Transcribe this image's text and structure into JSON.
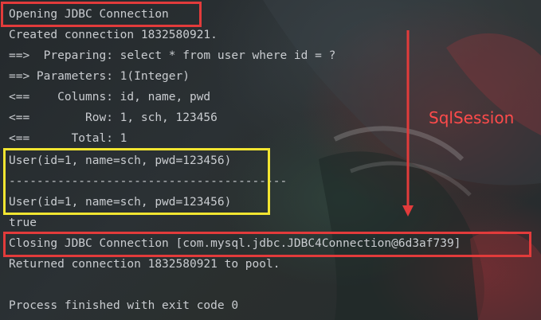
{
  "console": {
    "lines": [
      "Opening JDBC Connection",
      "Created connection 1832580921.",
      "==>  Preparing: select * from user where id = ?",
      "==> Parameters: 1(Integer)",
      "<==    Columns: id, name, pwd",
      "<==        Row: 1, sch, 123456",
      "<==      Total: 1",
      "User(id=1, name=sch, pwd=123456)",
      "----------------------------------------",
      "User(id=1, name=sch, pwd=123456)",
      "true",
      "Closing JDBC Connection [com.mysql.jdbc.JDBC4Connection@6d3af739]",
      "Returned connection 1832580921 to pool.",
      "",
      "Process finished with exit code 0"
    ]
  },
  "annotation": {
    "label": "SqlSession",
    "color": "#ff4b4b"
  },
  "highlight_colors": {
    "red": "#e23b3b",
    "yellow": "#f2e531"
  }
}
